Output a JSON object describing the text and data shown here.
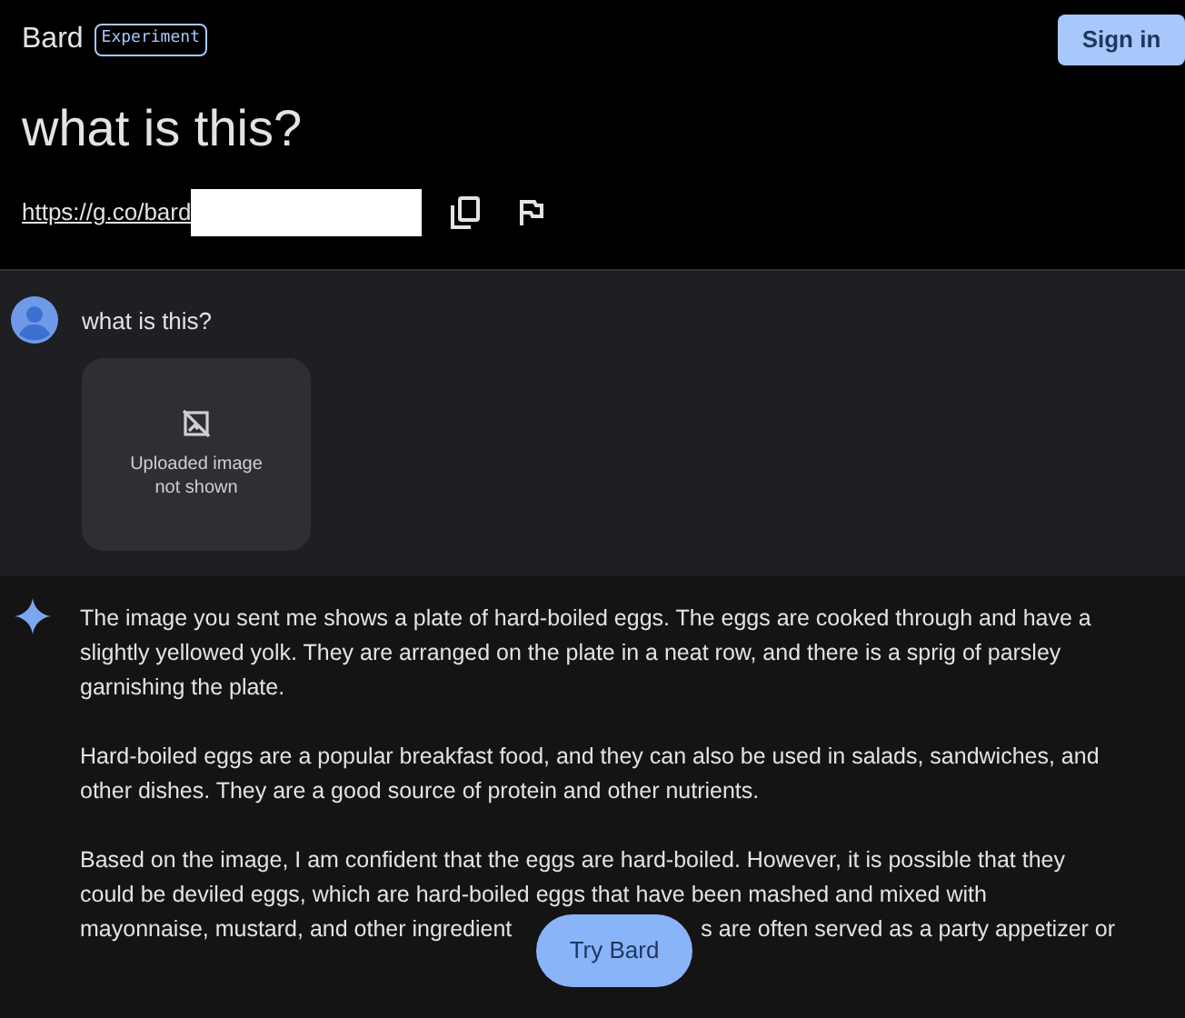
{
  "header": {
    "brand": "Bard",
    "badge": "Experiment",
    "sign_in": "Sign in"
  },
  "title": "what is this?",
  "share_link": "https://g.co/bard",
  "user_message": {
    "text": "what is this?",
    "attachment": "Uploaded image not shown"
  },
  "response": {
    "paragraphs": [
      "The image you sent me shows a plate of hard-boiled eggs. The eggs are cooked through and have a slightly yellowed yolk. They are arranged on the plate in a neat row, and there is a sprig of parsley garnishing the plate.",
      "Hard-boiled eggs are a popular breakfast food, and they can also be used in salads, sandwiches, and other dishes. They are a good source of protein and other nutrients."
    ],
    "last_paragraph_lines": [
      [
        "Based on the image, I am confident that the eggs are hard-boiled. However, it is possible that they"
      ],
      [
        "could be deviled eggs, which are hard-boiled eggs that have been mashed and mixed with"
      ],
      [
        "mayonnaise, mustard, and other ingredient",
        "s are often served as a party appetizer or"
      ]
    ]
  },
  "floating_button": "Try Bard"
}
